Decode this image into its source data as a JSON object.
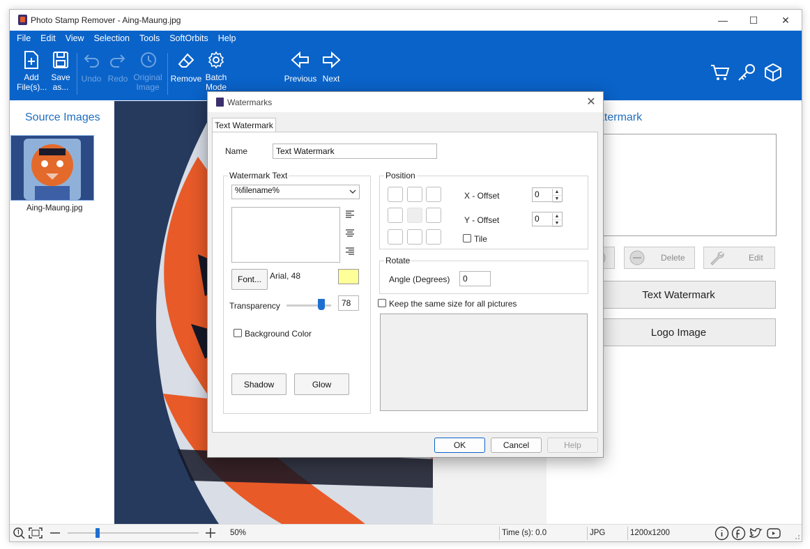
{
  "window": {
    "title": "Photo Stamp Remover - Aing-Maung.jpg",
    "minimize": "—",
    "maximize": "☐",
    "close": "✕"
  },
  "menu": [
    "File",
    "Edit",
    "View",
    "Selection",
    "Tools",
    "SoftOrbits",
    "Help"
  ],
  "toolbar": {
    "add_files": [
      "Add",
      "File(s)..."
    ],
    "save_as": [
      "Save",
      "as..."
    ],
    "undo": "Undo",
    "redo": "Redo",
    "original_image": [
      "Original",
      "Image"
    ],
    "remove": "Remove",
    "batch_mode": [
      "Batch",
      "Mode"
    ],
    "previous": "Previous",
    "next": "Next",
    "right_icons": [
      "cart-icon",
      "key-icon",
      "box-icon"
    ]
  },
  "left_panel": {
    "title": "Source Images",
    "thumbnail_caption": "Aing-Maung.jpg"
  },
  "right_panel": {
    "title": "atermark",
    "delete_label": "Delete",
    "edit_label": "Edit",
    "text_watermark_button": "Text Watermark",
    "logo_image_button": "Logo Image"
  },
  "statusbar": {
    "zoom": "50%",
    "zoom_slider_fraction": 0.23,
    "time": "Time (s): 0.0",
    "format": "JPG",
    "dimensions": "1200x1200",
    "social_icons": [
      "info-icon",
      "facebook-icon",
      "twitter-icon",
      "youtube-icon"
    ]
  },
  "dialog": {
    "title": "Watermarks",
    "close": "✕",
    "tab": "Text Watermark",
    "name_label": "Name",
    "name_value": "Text Watermark",
    "watermark_text_group": "Watermark Text",
    "text_dropdown_value": "%filename%",
    "font_button": "Font...",
    "font_value": "Arial, 48",
    "font_color": "#ffff99",
    "transparency_label": "Transparency",
    "transparency_value": "78",
    "transparency_fraction": 0.78,
    "background_color_label": "Background Color",
    "shadow_button": "Shadow",
    "glow_button": "Glow",
    "position_group": "Position",
    "x_offset_label": "X - Offset",
    "x_offset_value": "0",
    "y_offset_label": "Y - Offset",
    "y_offset_value": "0",
    "tile_label": "Tile",
    "rotate_group": "Rotate",
    "angle_label": "Angle (Degrees)",
    "angle_value": "0",
    "keep_size_label": "Keep the same size for all pictures",
    "ok_button": "OK",
    "cancel_button": "Cancel",
    "help_button": "Help"
  },
  "colors": {
    "accent": "#0a63c9",
    "link_blue": "#1f6ec0",
    "slider_thumb": "#1f6fd0"
  }
}
